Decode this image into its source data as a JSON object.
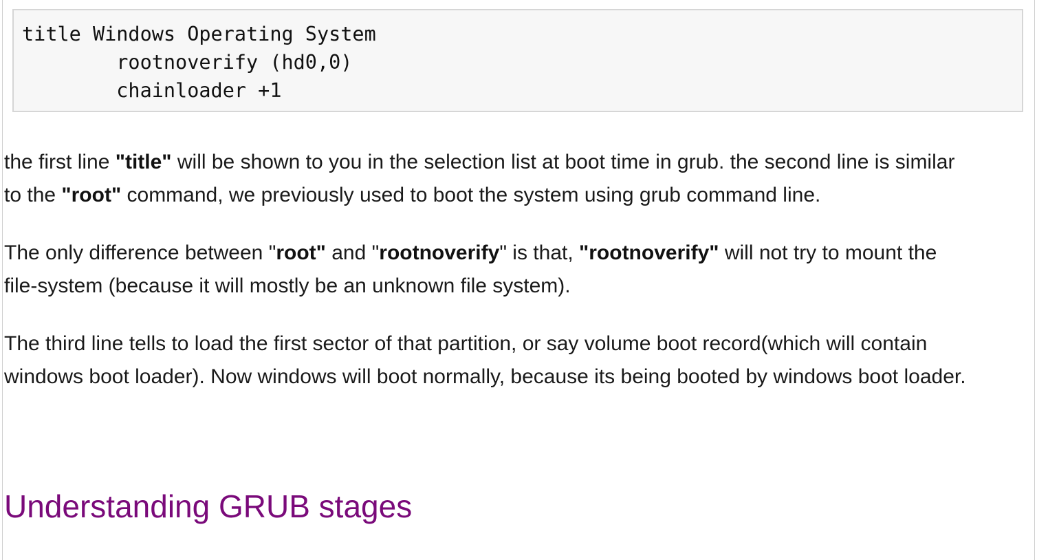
{
  "code_block": {
    "lines": [
      "title Windows Operating System",
      "        rootnoverify (hd0,0)",
      "        chainloader +1"
    ]
  },
  "paragraph1": {
    "l1_a": "the first line ",
    "l1_b": "\"title\"",
    "l1_c": " will be shown to you in the selection list at boot time in grub. the second line is similar",
    "l2_a": "to the ",
    "l2_b": "\"root\"",
    "l2_c": " command, we previously used to boot the system using grub command line."
  },
  "paragraph2": {
    "l1_a": "The only difference between \"",
    "l1_b": "root\"",
    "l1_c": " and \"",
    "l1_d": "rootnoverify",
    "l1_e": "\" is that, ",
    "l1_f": "\"rootnoverify\"",
    "l1_g": " will not try to mount the",
    "l2": "file-system (because it will mostly be an unknown file system)."
  },
  "paragraph3": {
    "l1": "The third line tells to load the first sector of that partition, or say volume boot record(which will contain",
    "l2": "windows boot loader). Now windows will boot normally, because its being booted by windows boot loader."
  },
  "section_heading": "Understanding GRUB stages",
  "colors": {
    "heading": "#7a0a7a",
    "code_background": "#f7f7f7",
    "code_border": "#d6d6d6"
  }
}
